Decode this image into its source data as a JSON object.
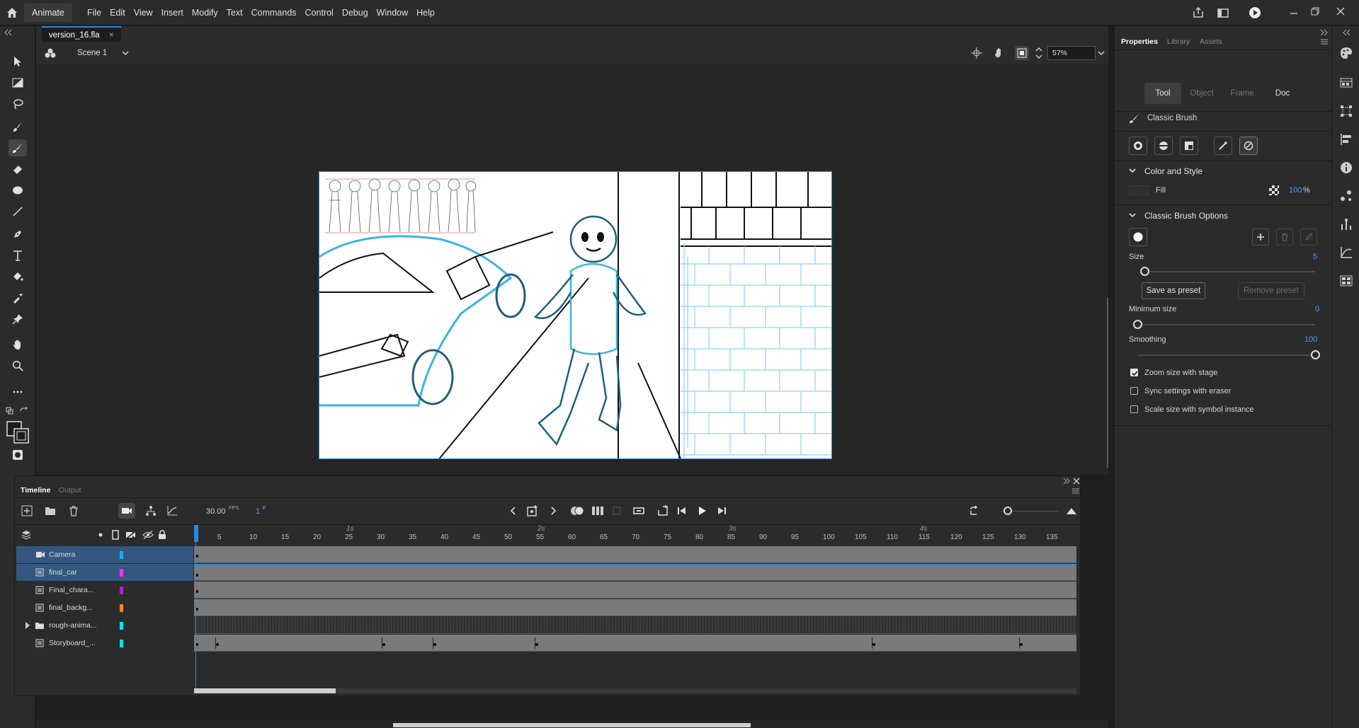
{
  "app": {
    "name": "Animate"
  },
  "menu": [
    "File",
    "Edit",
    "View",
    "Insert",
    "Modify",
    "Text",
    "Commands",
    "Control",
    "Debug",
    "Window",
    "Help"
  ],
  "document": {
    "tab_label": "version_16.fla",
    "close_glyph": "×"
  },
  "scene": {
    "label": "Scene 1",
    "zoom": "57%"
  },
  "properties": {
    "tabs": [
      "Properties",
      "Library",
      "Assets"
    ],
    "segments": [
      "Tool",
      "Object",
      "Frame",
      "Doc"
    ],
    "tool_name": "Classic Brush",
    "color_style": {
      "heading": "Color and Style",
      "fill_label": "Fill",
      "alpha": "100",
      "percent": "%"
    },
    "brush_options": {
      "heading": "Classic Brush Options",
      "size_label": "Size",
      "size_value": "5",
      "size_level": 0.02,
      "save_preset": "Save as preset",
      "remove_preset": "Remove preset",
      "min_size_label": "Minimum size",
      "min_size_value": "0",
      "min_size_level": 0.0,
      "smoothing_label": "Smoothing",
      "smoothing_value": "100",
      "smoothing_level": 1.0
    },
    "checkboxes": [
      {
        "label": "Zoom size with stage",
        "checked": true
      },
      {
        "label": "Sync settings with eraser",
        "checked": false
      },
      {
        "label": "Scale size with symbol instance",
        "checked": false
      }
    ]
  },
  "timeline": {
    "tabs": [
      "Timeline",
      "Output"
    ],
    "fps": "30.00",
    "fps_unit": "FPS",
    "frame": "1",
    "frame_unit": "F",
    "seconds": [
      "1s",
      "2s",
      "3s",
      "4s"
    ],
    "frame_numbers": [
      "5",
      "10",
      "15",
      "20",
      "25",
      "30",
      "35",
      "40",
      "45",
      "50",
      "55",
      "60",
      "65",
      "70",
      "75",
      "80",
      "85",
      "90",
      "95",
      "100",
      "105",
      "110",
      "115",
      "120",
      "125",
      "130",
      "135"
    ],
    "layers": [
      {
        "name": "Camera",
        "color": "#1aa8ff",
        "selected": true
      },
      {
        "name": "final_car",
        "color": "#ff2cff",
        "selected": true
      },
      {
        "name": "Final_chara...",
        "color": "#a026d0",
        "selected": false
      },
      {
        "name": "final_backg...",
        "color": "#ff8a1a",
        "selected": false
      },
      {
        "name": "rough-anima...",
        "color": "#00e5e5",
        "selected": false
      },
      {
        "name": "Storyboard_...",
        "color": "#00e5e5",
        "selected": false
      }
    ]
  },
  "icons": [
    "home-icon",
    "selection-tool-icon",
    "gradient-icon",
    "lasso-icon",
    "paint-brush-icon",
    "classic-brush-icon",
    "eraser-icon",
    "oval-icon",
    "line-icon",
    "pen-icon",
    "text-icon",
    "paint-bucket-icon",
    "eyedropper-icon",
    "pin-icon",
    "hand-icon",
    "zoom-icon",
    "more-tools-icon",
    "play-icon",
    "camera-icon"
  ],
  "colors": {
    "accent": "#2e88e0",
    "panel": "#2b2b2b",
    "app_bg": "#1e1e1e",
    "stage": "#ffffff",
    "selected_layer": "#33577e"
  }
}
